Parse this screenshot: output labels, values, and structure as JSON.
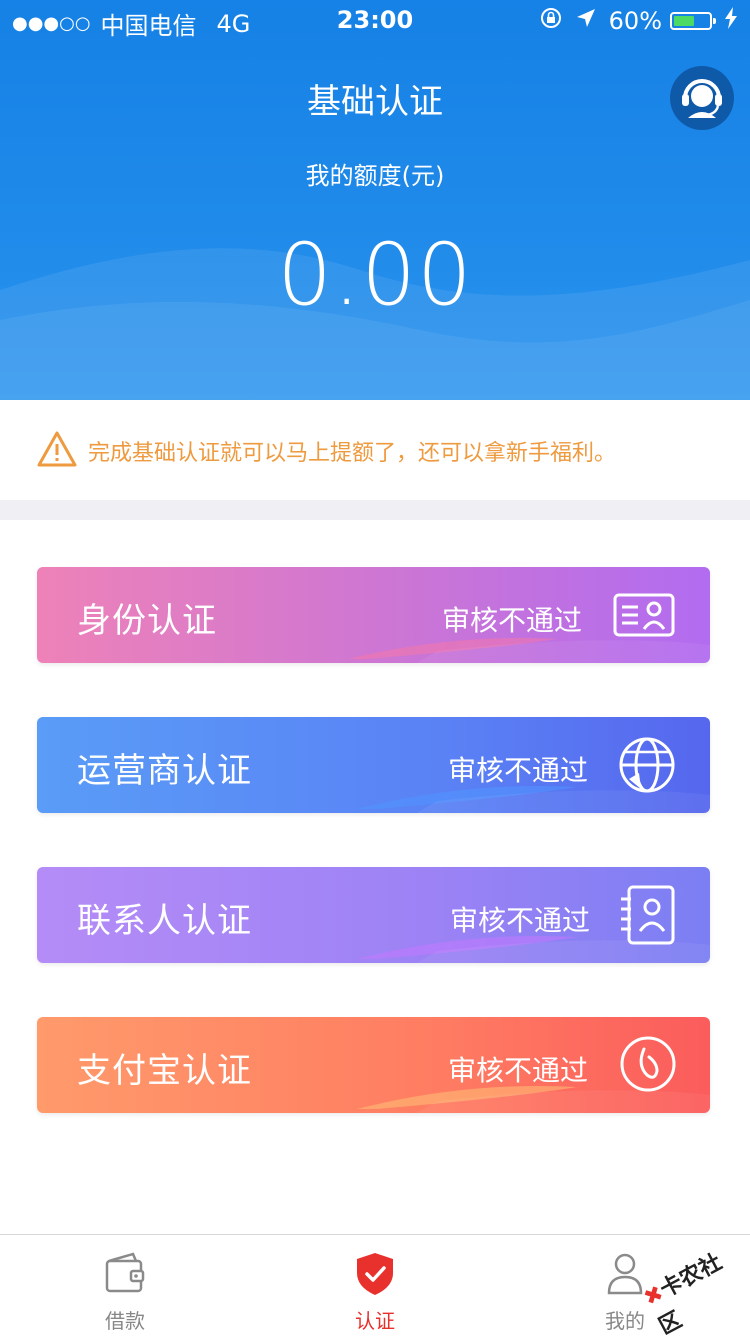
{
  "status_bar": {
    "signal": "●●●○○",
    "carrier": "中国电信",
    "network": "4G",
    "time": "23:00",
    "battery": "60%",
    "battery_level": 0.6
  },
  "header": {
    "title": "基础认证",
    "quota_label": "我的额度(元)",
    "quota_value": "0.00"
  },
  "notice": {
    "text": "完成基础认证就可以马上提额了，还可以拿新手福利。"
  },
  "cards": [
    {
      "label": "身份认证",
      "status": "审核不通过",
      "icon": "id-card-icon"
    },
    {
      "label": "运营商认证",
      "status": "审核不通过",
      "icon": "globe-phone-icon"
    },
    {
      "label": "联系人认证",
      "status": "审核不通过",
      "icon": "contact-book-icon"
    },
    {
      "label": "支付宝认证",
      "status": "审核不通过",
      "icon": "alipay-icon"
    }
  ],
  "tabs": [
    {
      "label": "借款",
      "icon": "wallet-icon",
      "active": false
    },
    {
      "label": "认证",
      "icon": "shield-check-icon",
      "active": true
    },
    {
      "label": "我的",
      "icon": "user-icon",
      "active": false
    }
  ],
  "watermark": "卡农社区",
  "colors": {
    "header_blue": "#1681e6",
    "warning_orange": "#ee9a3f",
    "tab_active_red": "#e8302c"
  }
}
